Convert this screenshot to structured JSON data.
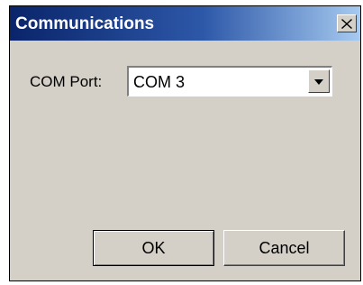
{
  "window": {
    "title": "Communications",
    "close_icon": "close-icon"
  },
  "form": {
    "com_port_label": "COM Port:",
    "com_port_value": "COM 3",
    "dropdown_icon": "chevron-down-icon"
  },
  "buttons": {
    "ok_label": "OK",
    "cancel_label": "Cancel"
  },
  "colors": {
    "titlebar_start": "#0a246a",
    "titlebar_end": "#a6caf0",
    "dialog_face": "#d4d0c8"
  }
}
